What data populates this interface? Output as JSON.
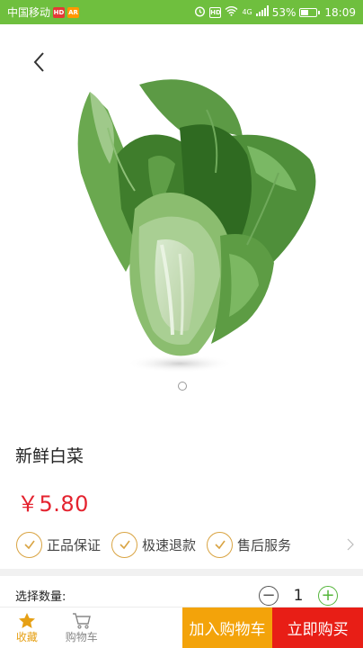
{
  "status_bar": {
    "carrier": "中国移动",
    "badge_hd": "HD",
    "badge_ar": "AR",
    "network": "4G",
    "battery": "53%",
    "battery_level": 0.53,
    "time": "18:09"
  },
  "product": {
    "title": "新鲜白菜",
    "price": "￥5.80",
    "image_icon": "cabbage-image",
    "carousel_index": 1,
    "carousel_count": 1
  },
  "guarantees": [
    {
      "label": "正品保证",
      "icon": "check-circle-icon"
    },
    {
      "label": "极速退款",
      "icon": "check-circle-icon"
    },
    {
      "label": "售后服务",
      "icon": "check-circle-icon"
    }
  ],
  "quantity": {
    "label": "选择数量:",
    "value": "1",
    "minus": "−",
    "plus": "+"
  },
  "bottom_bar": {
    "favorite_label": "收藏",
    "cart_label": "购物车",
    "add_to_cart": "加入购物车",
    "buy_now": "立即购买"
  },
  "colors": {
    "status_bar": "#6fbf3e",
    "price": "#e4232f",
    "guarantee_ring": "#d9a443",
    "favorite": "#e6a015",
    "add_to_cart": "#f3a30a",
    "buy_now": "#e81e16",
    "plus": "#55b53b"
  }
}
